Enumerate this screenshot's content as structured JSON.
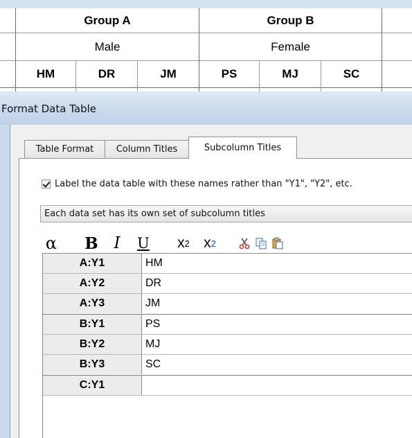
{
  "sheet": {
    "groups": [
      "Group A",
      "Group B"
    ],
    "sexes": [
      "Male",
      "Female"
    ],
    "subcolumns": [
      "HM",
      "DR",
      "JM",
      "PS",
      "MJ",
      "SC"
    ]
  },
  "dialog": {
    "title": "Format Data Table",
    "tabs": [
      {
        "label": "Table Format",
        "active": false
      },
      {
        "label": "Column Titles",
        "active": false
      },
      {
        "label": "Subcolumn Titles",
        "active": true
      }
    ],
    "checkbox": {
      "label": "Label the data table with these names rather than \"Y1\", \"Y2\", etc.",
      "checked": true
    },
    "combo": {
      "value": "Each data set has its own set of subcolumn titles"
    },
    "toolbar": {
      "icons": [
        "alpha-icon",
        "bold-icon",
        "italic-icon",
        "underline-icon",
        "superscript-icon",
        "subscript-icon",
        "cut-icon",
        "copy-icon",
        "paste-icon"
      ]
    },
    "grid": [
      {
        "label": "A:Y1",
        "value": "HM"
      },
      {
        "label": "A:Y2",
        "value": "DR"
      },
      {
        "label": "A:Y3",
        "value": "JM"
      },
      {
        "label": "B:Y1",
        "value": "PS"
      },
      {
        "label": "B:Y2",
        "value": "MJ"
      },
      {
        "label": "B:Y3",
        "value": "SC"
      },
      {
        "label": "C:Y1",
        "value": ""
      }
    ]
  }
}
